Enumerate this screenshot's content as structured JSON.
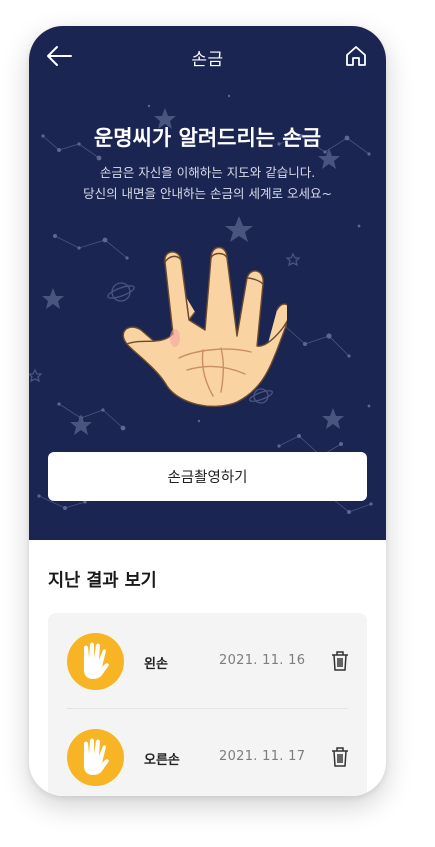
{
  "header": {
    "title": "손금",
    "back_icon": "arrow-left-icon",
    "home_icon": "home-icon"
  },
  "hero": {
    "headline": "운명씨가 알려드리는 손금",
    "subtext_line1": "손금은 자신을 이해하는 지도와 같습니다.",
    "subtext_line2": "당신의 내면을 안내하는 손금의 세계로 오세요~",
    "illustration": "palm-hand-illustration",
    "background_color": "#1b2551"
  },
  "capture_button": {
    "label": "손금촬영하기"
  },
  "past_results": {
    "title": "지난 결과 보기",
    "items": [
      {
        "hand": "왼손",
        "date": "2021. 11. 16",
        "icon": "hand-icon",
        "delete_icon": "trash-icon"
      },
      {
        "hand": "오른손",
        "date": "2021. 11. 17",
        "icon": "hand-icon",
        "delete_icon": "trash-icon"
      }
    ]
  },
  "colors": {
    "accent": "#f7b526",
    "card_background": "#f4f4f4",
    "skin": "#f9d3a2"
  }
}
